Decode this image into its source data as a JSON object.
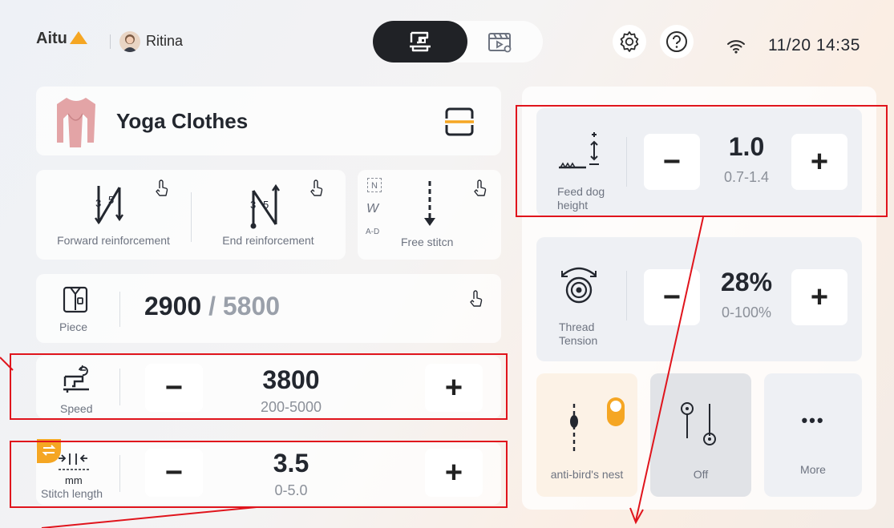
{
  "header": {
    "brand": "Aitu",
    "user": "Ritina",
    "time": "11/20 14:35"
  },
  "product": {
    "name": "Yoga Clothes"
  },
  "stitch_modes": [
    {
      "label": "Forward reinforcement",
      "num_a": "3",
      "num_b": "5"
    },
    {
      "label": "End reinforcement",
      "num_a": "3",
      "num_b": "5"
    },
    {
      "label": "Free stitcn",
      "codes": [
        "N",
        "W",
        "A-D"
      ]
    }
  ],
  "piece": {
    "label": "Piece",
    "current": "2900",
    "separator": "/",
    "total": "5800"
  },
  "speed": {
    "label": "Speed",
    "value": "3800",
    "range": "200-5000",
    "minus": "−",
    "plus": "+"
  },
  "stitch_length": {
    "label": "Stitch length",
    "unit": "mm",
    "value": "3.5",
    "range": "0-5.0",
    "minus": "−",
    "plus": "+"
  },
  "feed_dog": {
    "label": "Feed dog height",
    "value": "1.0",
    "range": "0.7-1.4",
    "minus": "−",
    "plus": "+"
  },
  "thread_tension": {
    "label": "Thread Tension",
    "value": "28%",
    "range": "0-100%",
    "minus": "−",
    "plus": "+"
  },
  "toggles": [
    {
      "label": "anti-bird's nest"
    },
    {
      "label": "Off"
    },
    {
      "label": "More",
      "glyph": "•••"
    }
  ],
  "colors": {
    "accent": "#f5a623",
    "highlight": "#e0141c",
    "dark": "#202226"
  }
}
